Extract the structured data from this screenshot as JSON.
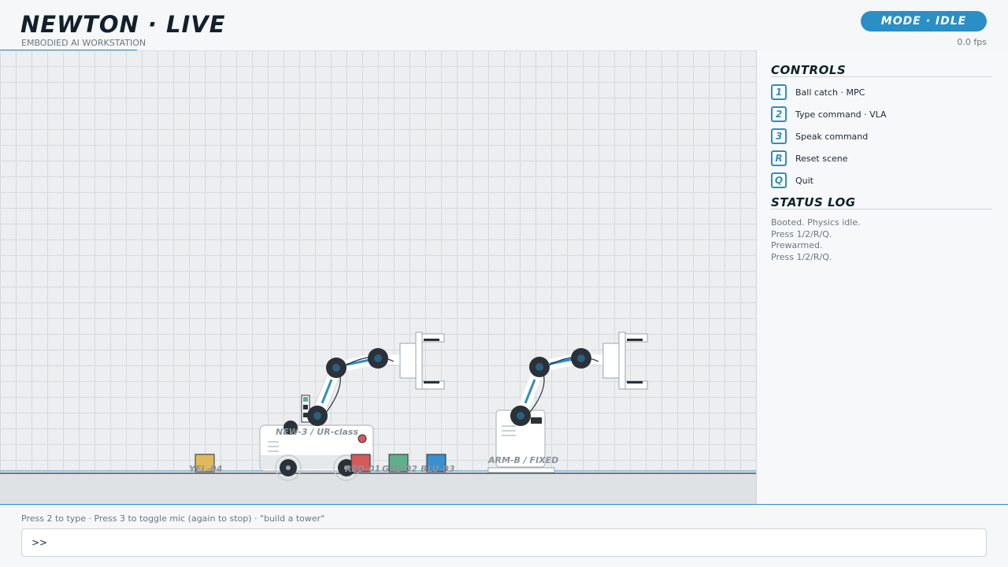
{
  "header": {
    "title": "NEWTON · LIVE",
    "subtitle": "EMBODIED AI WORKSTATION",
    "mode": "MODE · IDLE",
    "fps": "0.0 fps"
  },
  "controls": {
    "title": "CONTROLS",
    "items": [
      {
        "key": "1",
        "label": "Ball catch · MPC"
      },
      {
        "key": "2",
        "label": "Type command · VLA"
      },
      {
        "key": "3",
        "label": "Speak command"
      },
      {
        "key": "R",
        "label": "Reset scene"
      },
      {
        "key": "Q",
        "label": "Quit"
      }
    ]
  },
  "status_log": {
    "title": "STATUS LOG",
    "lines": [
      "Booted. Physics idle.",
      "Press 1/2/R/Q.",
      "Prewarmed.",
      "Press 1/2/R/Q."
    ]
  },
  "scene": {
    "mobile_robot_label": "NEW-3 / UR-class",
    "fixed_arm_label": "ARM-B / FIXED",
    "blocks": [
      {
        "label": "YEL-04",
        "color": "#e0b85e"
      },
      {
        "label": "RED-01",
        "color": "#d55a5a"
      },
      {
        "label": "GRE-02",
        "color": "#5fae8c"
      },
      {
        "label": "BLU-03",
        "color": "#3a8fcf"
      }
    ]
  },
  "command": {
    "hint": "Press 2 to type  ·  Press 3 to toggle mic (again to stop)  ·  \"build a tower\"",
    "prompt": ">>",
    "placeholder": "",
    "value": ""
  },
  "colors": {
    "accent": "#2a8fc4",
    "arm_link": "#ffffff",
    "joint": "#2b3138"
  }
}
